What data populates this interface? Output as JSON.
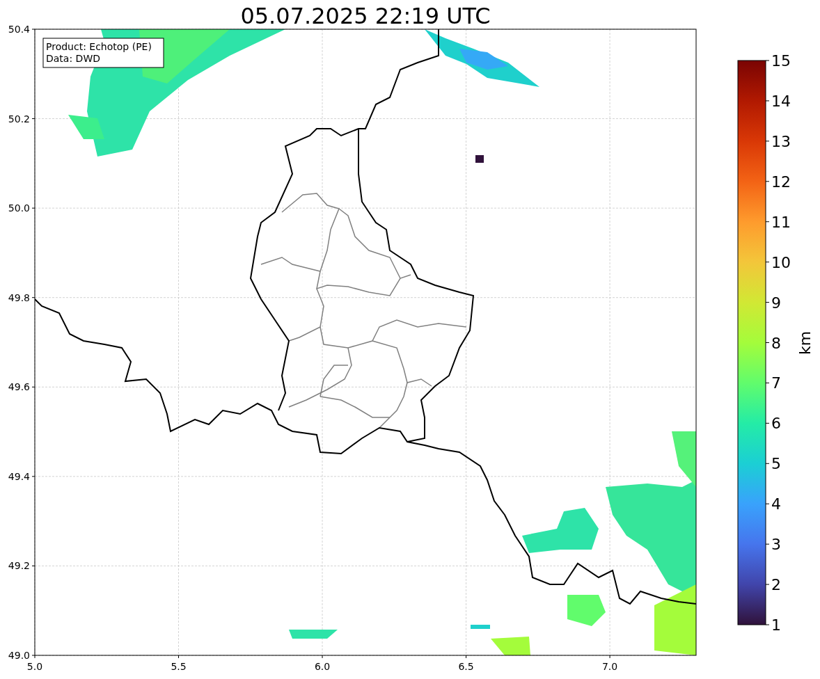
{
  "title": "05.07.2025 22:19 UTC",
  "legend": [
    "Product: Echotop (PE)",
    "Data: DWD"
  ],
  "x_ticks": [
    "5.0",
    "5.5",
    "6.0",
    "6.5",
    "7.0"
  ],
  "y_ticks": [
    "50.4",
    "50.2",
    "50.0",
    "49.8",
    "49.6",
    "49.4",
    "49.2",
    "49.0"
  ],
  "colorbar": {
    "label": "km",
    "ticks": [
      "15",
      "14",
      "13",
      "12",
      "11",
      "10",
      "9",
      "8",
      "7",
      "6",
      "5",
      "4",
      "3",
      "2",
      "1"
    ]
  }
}
